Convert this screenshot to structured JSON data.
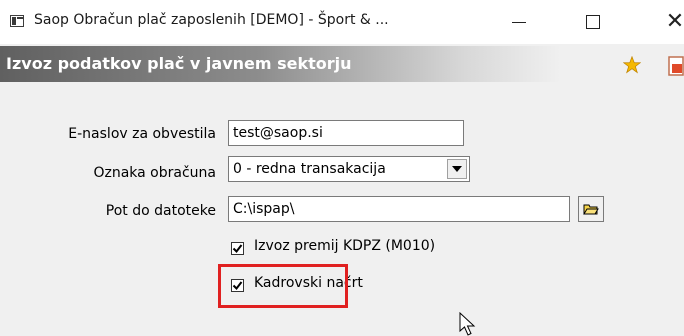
{
  "window": {
    "title": "Saop Obračun plač zaposlenih [DEMO] - Šport & ...",
    "app_icon": "window-icon",
    "controls": [
      "minimize-icon",
      "maximize-icon",
      "close-icon"
    ],
    "close_glyph": "✕"
  },
  "form": {
    "header_title": "Izvoz podatkov plač v javnem sektorju",
    "header_icons": [
      "star-icon",
      "document-icon"
    ],
    "fields": {
      "email": {
        "label": "E-naslov za obvestila",
        "value": "test@saop.si"
      },
      "type": {
        "label": "Oznaka obračuna",
        "value": "0 - redna transakacija"
      },
      "path": {
        "label": "Pot do datoteke",
        "value": "C:\\ispap\\",
        "browse_icon": "folder-open-icon"
      }
    },
    "checkboxes": [
      {
        "label": "Izvoz premij KDPZ (M010)",
        "checked": true
      },
      {
        "label": "Kadrovski načrt",
        "checked": true,
        "highlighted": true
      }
    ]
  },
  "colors": {
    "highlight": "#e02020",
    "star": "#f5b800"
  }
}
